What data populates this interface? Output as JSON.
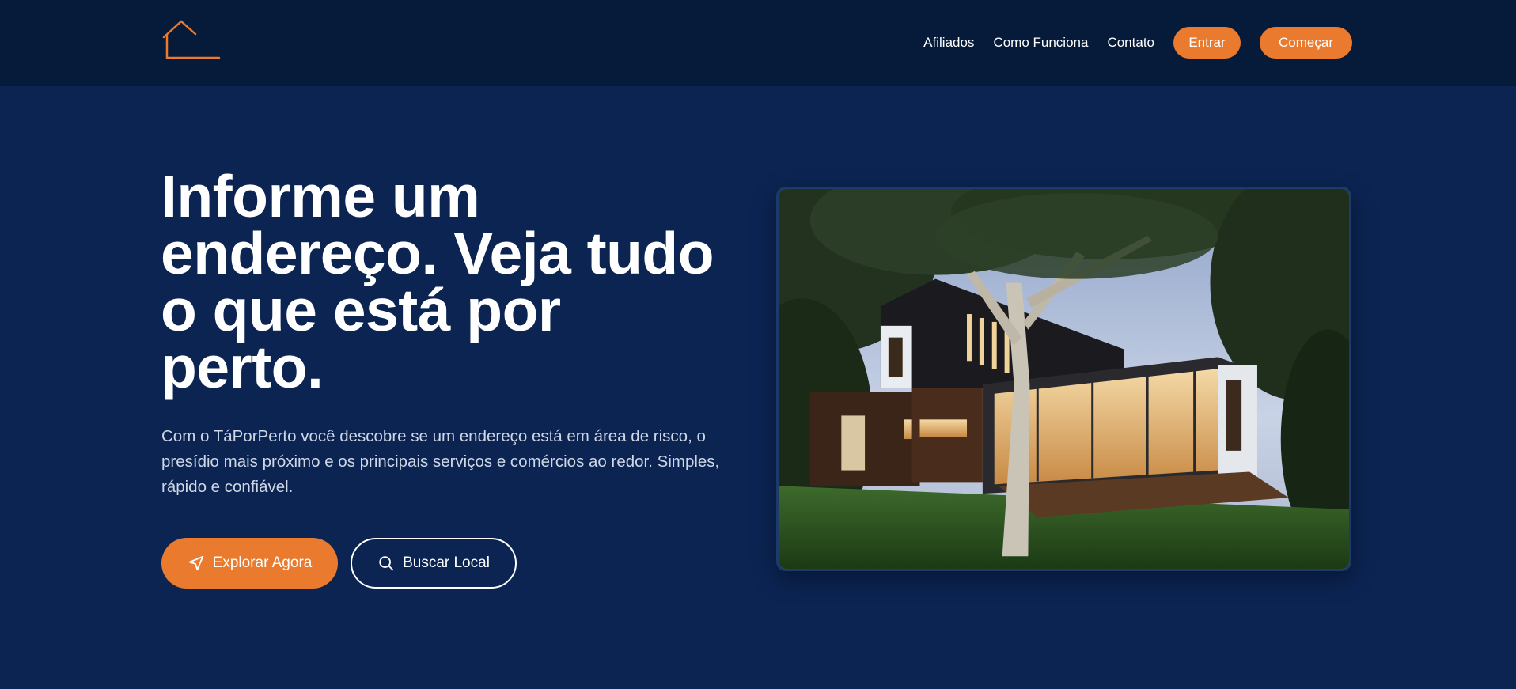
{
  "nav": {
    "logo_icon": "house-outline-icon",
    "links": [
      "Afiliados",
      "Como Funciona",
      "Contato"
    ],
    "login_label": "Entrar",
    "start_label": "Começar"
  },
  "hero": {
    "title": "Informe um endereço. Veja tudo o que está por perto.",
    "subtitle": "Com o TáPorPerto você descobre se um endereço está em área de risco, o presídio mais próximo e os principais serviços e comércios ao redor. Simples, rápido e confiável.",
    "primary_cta": {
      "label": "Explorar Agora",
      "icon": "navigation-arrow-icon"
    },
    "secondary_cta": {
      "label": "Buscar Local",
      "icon": "search-icon"
    },
    "image_subject": "modern-house-at-dusk"
  },
  "colors": {
    "header_bg": "#061a3a",
    "page_bg": "#0b2452",
    "accent": "#ea7b2e",
    "text": "#ffffff"
  }
}
